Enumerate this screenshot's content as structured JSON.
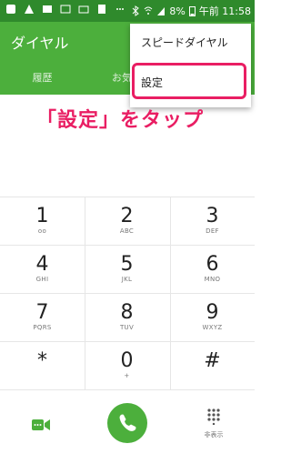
{
  "status": {
    "battery": "8%",
    "time": "午前 11:58"
  },
  "appbar": {
    "title": "ダイヤル",
    "tabs": [
      "履歴",
      "お気に"
    ]
  },
  "menu": {
    "items": [
      "スピードダイヤル",
      "設定"
    ]
  },
  "callout": "「設定」をタップ",
  "keys": [
    {
      "num": "1",
      "sub": "ᴏᴏ"
    },
    {
      "num": "2",
      "sub": "ABC"
    },
    {
      "num": "3",
      "sub": "DEF"
    },
    {
      "num": "4",
      "sub": "GHI"
    },
    {
      "num": "5",
      "sub": "JKL"
    },
    {
      "num": "6",
      "sub": "MNO"
    },
    {
      "num": "7",
      "sub": "PQRS"
    },
    {
      "num": "8",
      "sub": "TUV"
    },
    {
      "num": "9",
      "sub": "WXYZ"
    },
    {
      "num": "*",
      "sub": ""
    },
    {
      "num": "0",
      "sub": "+"
    },
    {
      "num": "#",
      "sub": ""
    }
  ],
  "bottom": {
    "hide_label": "非表示"
  },
  "colors": {
    "accent": "#4caf3c",
    "highlight": "#e91e63"
  }
}
